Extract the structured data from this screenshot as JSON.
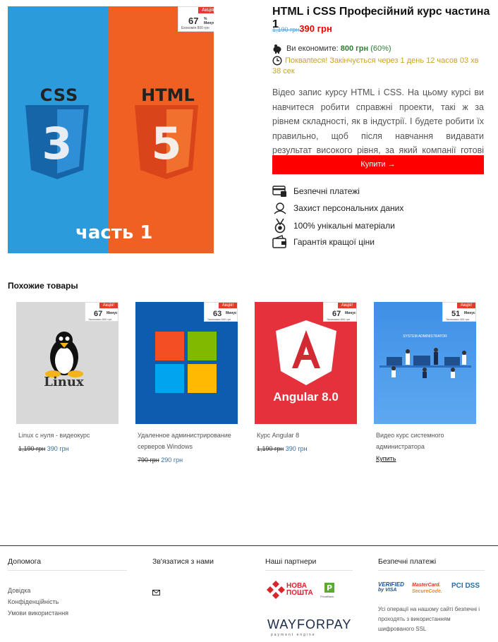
{
  "product": {
    "title": "HTML і CSS Професійний курс частина 1",
    "old_price": "1,190 грн",
    "new_price": "390 грн",
    "savings_label": "Ви економите:",
    "savings_amount": "800 грн",
    "savings_pct": "(60%)",
    "hurry_text": "Поквапtеся! Закінчується через 1 день 12 часов 03 хв 38 сек",
    "description": "Відео запис курсу HTML і CSS. На цьому курсі ви навчитеся робити справжні проекти, такі ж за рівнем складності, як в індустрії. І будете робити їх правильно, щоб після навчання видавати результат високого рівня, за який компанії готові платити.",
    "buy_label": "Купити →",
    "image": {
      "left_word": "CSS",
      "left_digit": "3",
      "right_word": "HTML",
      "right_digit": "5",
      "caption": "часть 1"
    },
    "promo": {
      "tag": "Акція!",
      "pct": "67",
      "pct_label": "% Минус",
      "save": "Економія 800 грн"
    }
  },
  "features": [
    {
      "label": "Безпечні платежі",
      "icon": "secure-payment-icon"
    },
    {
      "label": "Захист персональних даних",
      "icon": "data-protection-icon"
    },
    {
      "label": "100% унікальні матеріали",
      "icon": "medal-icon"
    },
    {
      "label": "Гарантія кращої ціни",
      "icon": "wallet-icon"
    }
  ],
  "related": {
    "heading": "Похожие товары",
    "items": [
      {
        "name": "Linux с нуля - видеокурс",
        "old": "1,190 грн",
        "new": "390 грн",
        "img_text": "Linux",
        "promo_tag": "Акція!",
        "promo_pct": "67",
        "promo_label": "Минус",
        "promo_save": "Экономия 800 грн"
      },
      {
        "name": "Удаленное администрирование серверов Windows",
        "old": "790 грн",
        "new": "290 грн",
        "img_text": "",
        "promo_tag": "Акція!",
        "promo_pct": "63",
        "promo_label": "Минус",
        "promo_save": "Экономия 500 грн"
      },
      {
        "name": "Курс Angular 8",
        "old": "1,190 грн",
        "new": "390 грн",
        "img_text": "Angular 8.0",
        "promo_tag": "Акція!",
        "promo_pct": "67",
        "promo_label": "Минус",
        "promo_save": "Экономия 800 грн"
      },
      {
        "name": "Видео курс системного администратора",
        "old": "",
        "new": "",
        "buy": "Купить",
        "img_text": "SYSTEM ADMINISTRATOR",
        "promo_tag": "Акція!",
        "promo_pct": "51",
        "promo_label": "Минус",
        "promo_save": "Экономия 400 грн"
      }
    ]
  },
  "footer": {
    "help": {
      "title": "Допомога",
      "links": [
        "Довідка",
        "Конфіденційність",
        "Умови використання"
      ]
    },
    "contact": {
      "title": "Зв'язатися з нами"
    },
    "partners": {
      "title": "Наші партнери",
      "nova_line1": "НОВА",
      "nova_line2": "ПОШТА",
      "privat": "PrivatBank",
      "wfp_main": "WAYFORPAY",
      "wfp_sub": "payment engine"
    },
    "payments": {
      "title": "Безпечні платежі",
      "visa_line1": "VERIFIED",
      "visa_line2": "by VISA",
      "mc_line1": "MasterCard.",
      "mc_line2": "SecureCode.",
      "pci": "PCI DSS",
      "note": "Усі операції на нашому сайті безпечні і проходять з використанням шифрованого SSL"
    }
  },
  "colors": {
    "accent": "#ff0000",
    "css_blue": "#2b9bdc",
    "html_orange": "#ef6022",
    "link_blue": "#3a6ea5",
    "savings_green": "#2e7d32",
    "hurry_gold": "#c9a227"
  }
}
